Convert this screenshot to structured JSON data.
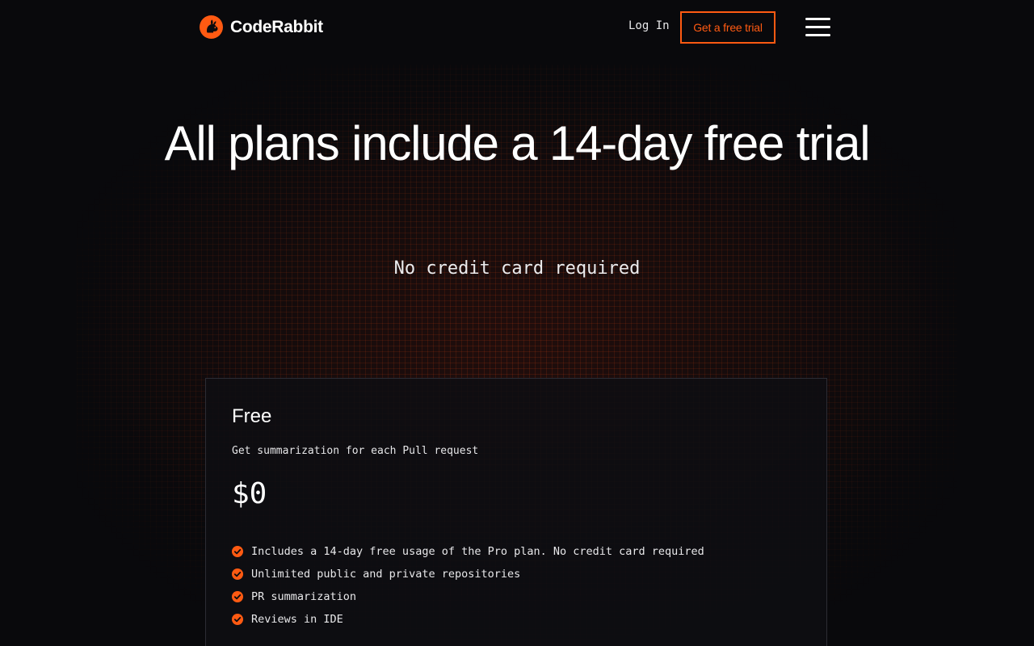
{
  "header": {
    "brand_name": "CodeRabbit",
    "login_label": "Log In",
    "trial_button_label": "Get a free trial",
    "menu_icon": "hamburger-menu-icon",
    "logo_icon": "rabbit-logo-icon"
  },
  "hero": {
    "title": "All plans include a 14-day free trial",
    "subtitle": "No credit card required"
  },
  "plan": {
    "name": "Free",
    "description": "Get summarization for each Pull request",
    "price": "$0",
    "features": [
      "Includes a 14-day free usage of the Pro plan. No credit card required",
      "Unlimited public and private repositories",
      "PR summarization",
      "Reviews in IDE"
    ]
  },
  "colors": {
    "accent": "#ff5a12",
    "background": "#09090c",
    "card_border": "#2c2c34"
  }
}
